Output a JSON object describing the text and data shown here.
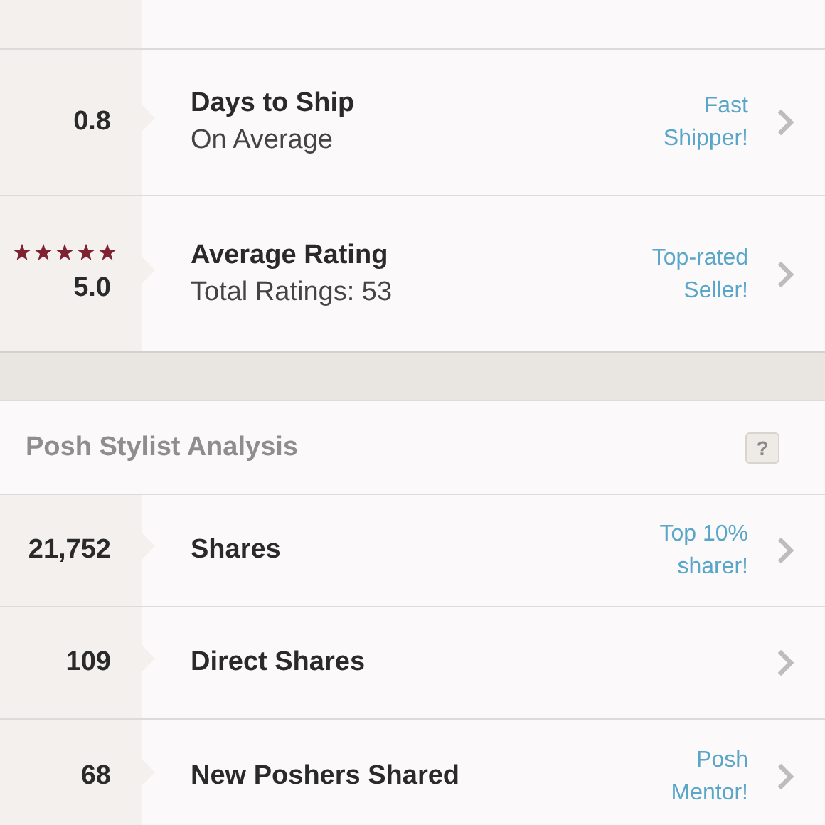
{
  "seller_stats": [
    {
      "value": "0.8",
      "title": "Days to Ship",
      "subtitle": "On Average",
      "badge": [
        "Fast",
        "Shipper!"
      ]
    },
    {
      "value": "5.0",
      "stars": 5,
      "title": "Average Rating",
      "subtitle": "Total Ratings: 53",
      "badge": [
        "Top-rated",
        "Seller!"
      ]
    }
  ],
  "stylist_analysis": {
    "heading": "Posh Stylist Analysis",
    "help_icon": "?",
    "rows": [
      {
        "value": "21,752",
        "title": "Shares",
        "badge": [
          "Top 10%",
          "sharer!"
        ]
      },
      {
        "value": "109",
        "title": "Direct Shares"
      },
      {
        "value": "68",
        "title": "New Poshers Shared",
        "badge": [
          "Posh",
          "Mentor!"
        ]
      }
    ]
  }
}
